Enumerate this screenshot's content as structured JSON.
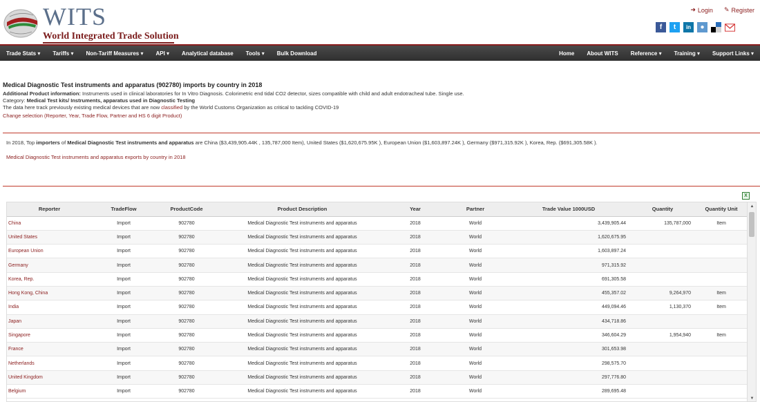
{
  "header": {
    "logo_title": "WITS",
    "logo_subtitle": "World Integrated Trade Solution",
    "login": "Login",
    "register": "Register"
  },
  "social": [
    "facebook-icon",
    "twitter-icon",
    "linkedin-icon",
    "reddit-icon",
    "delicious-icon",
    "email-icon"
  ],
  "nav": {
    "left": [
      "Trade Stats ▾",
      "Tariffs ▾",
      "Non-Tariff Measures ▾",
      "API ▾",
      "Analytical database",
      "Tools ▾",
      "Bulk Download"
    ],
    "right": [
      "Home",
      "About WITS",
      "Reference ▾",
      "Training ▾",
      "Support Links ▾"
    ]
  },
  "intro": {
    "title": "Medical Diagnostic Test instruments and apparatus (902780) imports by country in 2018",
    "add_info_label": "Additional Product information:",
    "add_info_text": " Instruments used in clinical laboratories for In Vitro Diagnosis. Colorimetric end tidal CO2 detector, sizes compatible with child and adult endotracheal tube. Single use.",
    "category_label": "Category: ",
    "category_value": "Medical Test kits/ Instruments, apparatus used in Diagnostic Testing",
    "covid_pre": "The data here track previously existing medical devices that are now ",
    "covid_link": "classified",
    "covid_post": " by the World Customs Organization as critical to tackling COVID-19",
    "change_selection": "Change selection (Reporter, Year, Trade Flow, Partner and HS 6 digit Product)"
  },
  "summary": {
    "pre": "In 2018, Top ",
    "importers": "importers",
    "of": " of ",
    "product": "Medical Diagnostic Test instruments and apparatus",
    "rest": " are China ($3,439,905.44K , 135,787,000 Item), United States ($1,620,675.95K ), European Union ($1,603,897.24K ), Germany ($971,315.92K ), Korea, Rep. ($691,305.58K )."
  },
  "exports_link": "Medical Diagnostic Test instruments and apparatus exports by country in 2018",
  "table": {
    "headers": [
      "Reporter",
      "TradeFlow",
      "ProductCode",
      "Product Description",
      "Year",
      "Partner",
      "Trade Value 1000USD",
      "Quantity",
      "Quantity Unit"
    ],
    "rows": [
      [
        "China",
        "Import",
        "902780",
        "Medical Diagnostic Test instruments and apparatus",
        "2018",
        "World",
        "3,439,905.44",
        "135,787,000",
        "Item"
      ],
      [
        "United States",
        "Import",
        "902780",
        "Medical Diagnostic Test instruments and apparatus",
        "2018",
        "World",
        "1,620,675.95",
        "",
        ""
      ],
      [
        "European Union",
        "Import",
        "902780",
        "Medical Diagnostic Test instruments and apparatus",
        "2018",
        "World",
        "1,603,897.24",
        "",
        ""
      ],
      [
        "Germany",
        "Import",
        "902780",
        "Medical Diagnostic Test instruments and apparatus",
        "2018",
        "World",
        "971,315.92",
        "",
        ""
      ],
      [
        "Korea, Rep.",
        "Import",
        "902780",
        "Medical Diagnostic Test instruments and apparatus",
        "2018",
        "World",
        "691,305.58",
        "",
        ""
      ],
      [
        "Hong Kong, China",
        "Import",
        "902780",
        "Medical Diagnostic Test instruments and apparatus",
        "2018",
        "World",
        "455,357.02",
        "9,264,970",
        "Item"
      ],
      [
        "India",
        "Import",
        "902780",
        "Medical Diagnostic Test instruments and apparatus",
        "2018",
        "World",
        "449,094.46",
        "1,130,370",
        "Item"
      ],
      [
        "Japan",
        "Import",
        "902780",
        "Medical Diagnostic Test instruments and apparatus",
        "2018",
        "World",
        "434,718.86",
        "",
        ""
      ],
      [
        "Singapore",
        "Import",
        "902780",
        "Medical Diagnostic Test instruments and apparatus",
        "2018",
        "World",
        "346,604.29",
        "1,954,940",
        "Item"
      ],
      [
        "France",
        "Import",
        "902780",
        "Medical Diagnostic Test instruments and apparatus",
        "2018",
        "World",
        "301,653.98",
        "",
        ""
      ],
      [
        "Netherlands",
        "Import",
        "902780",
        "Medical Diagnostic Test instruments and apparatus",
        "2018",
        "World",
        "298,575.70",
        "",
        ""
      ],
      [
        "United Kingdom",
        "Import",
        "902780",
        "Medical Diagnostic Test instruments and apparatus",
        "2018",
        "World",
        "297,776.80",
        "",
        ""
      ],
      [
        "Belgium",
        "Import",
        "902780",
        "Medical Diagnostic Test instruments and apparatus",
        "2018",
        "World",
        "289,695.48",
        "",
        ""
      ]
    ]
  },
  "colors": {
    "brand_red": "#8a1c1c",
    "nav_bg": "#3a3a3a",
    "logo_blue": "#5b6f8a"
  }
}
